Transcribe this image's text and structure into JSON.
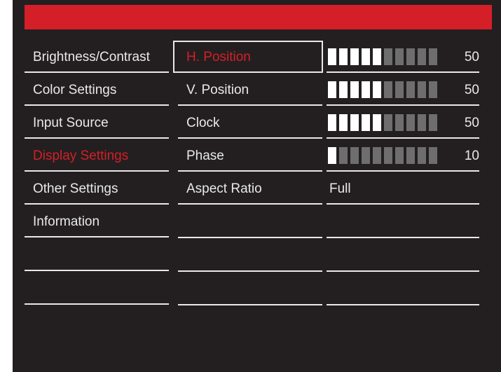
{
  "main_menu": [
    {
      "label": "Brightness/Contrast",
      "active": false
    },
    {
      "label": "Color Settings",
      "active": false
    },
    {
      "label": "Input Source",
      "active": false
    },
    {
      "label": "Display Settings",
      "active": true
    },
    {
      "label": "Other Settings",
      "active": false
    },
    {
      "label": "Information",
      "active": false
    }
  ],
  "sub_menu": [
    {
      "label": "H. Position",
      "selected": true
    },
    {
      "label": "V. Position",
      "selected": false
    },
    {
      "label": "Clock",
      "selected": false
    },
    {
      "label": "Phase",
      "selected": false
    },
    {
      "label": "Aspect Ratio",
      "selected": false
    }
  ],
  "values": [
    {
      "type": "bar",
      "value": "50",
      "level": 0.5
    },
    {
      "type": "bar",
      "value": "50",
      "level": 0.5
    },
    {
      "type": "bar",
      "value": "50",
      "level": 0.5
    },
    {
      "type": "bar",
      "value": "10",
      "level": 0.1
    },
    {
      "type": "text",
      "value": "Full"
    }
  ],
  "colors": {
    "accent": "#d51f28",
    "background": "#231f20",
    "text": "#e9e9e9"
  }
}
